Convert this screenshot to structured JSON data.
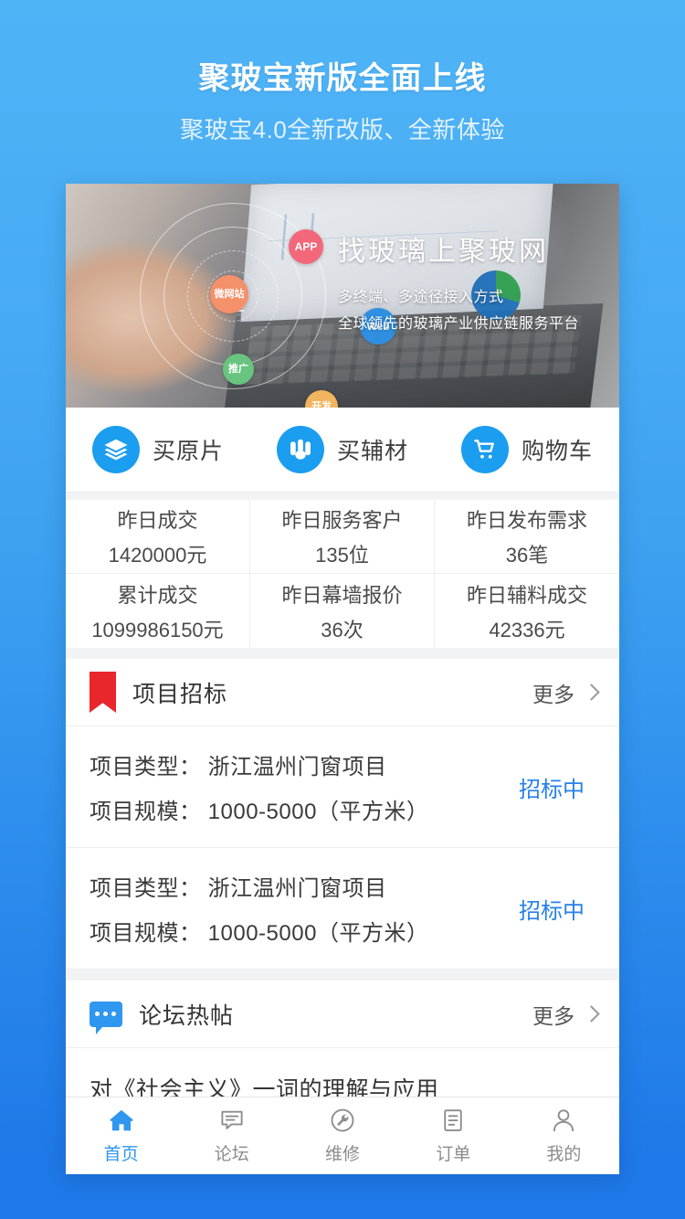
{
  "promo": {
    "title": "聚玻宝新版全面上线",
    "subtitle": "聚玻宝4.0全新改版、全新体验"
  },
  "banner": {
    "headline": "找玻璃上聚玻网",
    "line1": "多终端、多途径接入方式",
    "line2": "全球领先的玻璃产业供应链服务平台",
    "nodes": [
      {
        "label": "APP",
        "color": "#f2687a"
      },
      {
        "label": "微网站",
        "color": "#f4906a"
      },
      {
        "label": "推广",
        "color": "#68c47e"
      },
      {
        "label": "开发",
        "color": "#f1b45f"
      },
      {
        "label": "Web",
        "color": "#2f8fe0"
      }
    ]
  },
  "actions": [
    {
      "label": "买原片",
      "icon": "layers-icon"
    },
    {
      "label": "买辅材",
      "icon": "material-rolls-icon"
    },
    {
      "label": "购物车",
      "icon": "shopping-cart-icon"
    }
  ],
  "stats": [
    {
      "label": "昨日成交",
      "value": "1420000元"
    },
    {
      "label": "昨日服务客户",
      "value": "135位"
    },
    {
      "label": "昨日发布需求",
      "value": "36笔"
    },
    {
      "label": "累计成交",
      "value": "1099986150元"
    },
    {
      "label": "昨日幕墙报价",
      "value": "36次"
    },
    {
      "label": "昨日辅料成交",
      "value": "42336元"
    }
  ],
  "bidding": {
    "title": "项目招标",
    "more": "更多",
    "items": [
      {
        "type_line": "项目类型： 浙江温州门窗项目",
        "scale_line": "项目规模： 1000-5000（平方米）",
        "status": "招标中"
      },
      {
        "type_line": "项目类型： 浙江温州门窗项目",
        "scale_line": "项目规模： 1000-5000（平方米）",
        "status": "招标中"
      }
    ]
  },
  "forum": {
    "title": "论坛热帖",
    "more": "更多",
    "posts": [
      {
        "title": "对《社会主义》一词的理解与应用"
      }
    ]
  },
  "tabbar": [
    {
      "label": "首页",
      "icon": "home-icon",
      "active": true
    },
    {
      "label": "论坛",
      "icon": "forum-icon",
      "active": false
    },
    {
      "label": "维修",
      "icon": "wrench-icon",
      "active": false
    },
    {
      "label": "订单",
      "icon": "order-icon",
      "active": false
    },
    {
      "label": "我的",
      "icon": "person-icon",
      "active": false
    }
  ],
  "colors": {
    "background_top": "#4fb4f6",
    "background_bottom": "#1f79e8",
    "accent": "#1b9df0",
    "status_link": "#2680eb",
    "bookmark": "#e8262c"
  }
}
